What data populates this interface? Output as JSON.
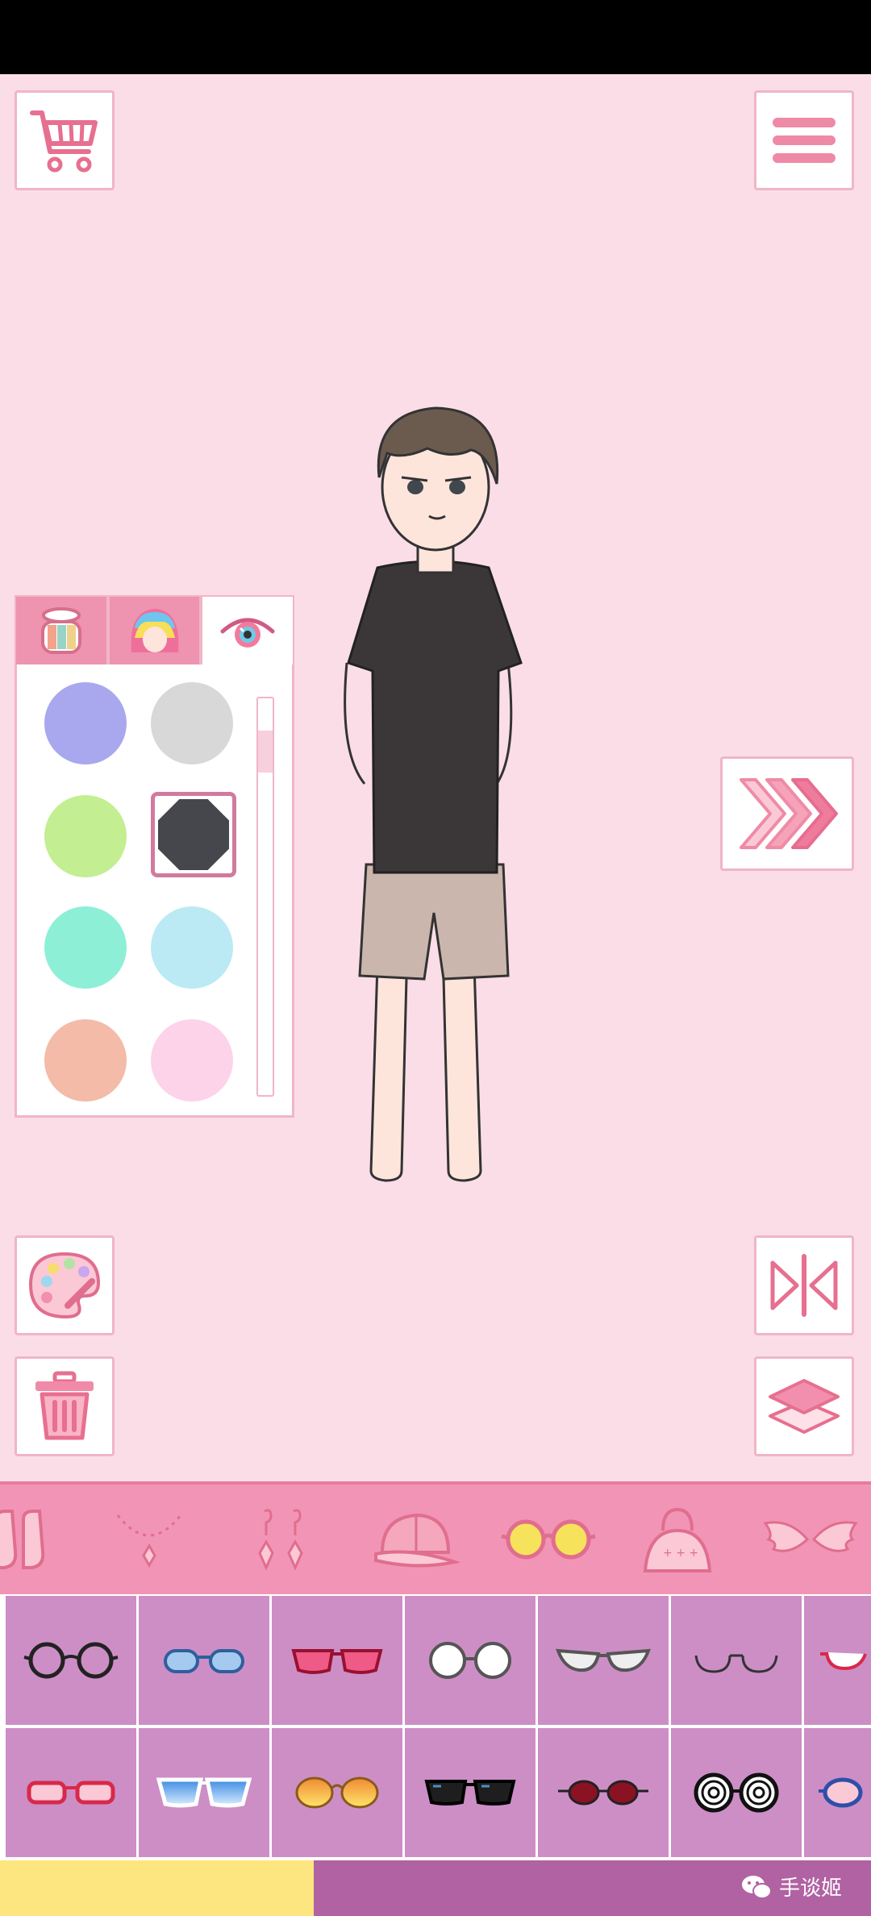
{
  "colors": {
    "stage_bg": "#fbdde8",
    "accent": "#f294b6",
    "grid_cell": "#cd8ec6",
    "progress": "#fde680"
  },
  "top_bar": {
    "left_icon": "shopping-cart-icon",
    "right_icon": "hamburger-menu-icon"
  },
  "color_panel": {
    "tabs": [
      {
        "icon": "eyeshadow-icon",
        "active": false
      },
      {
        "icon": "rainbow-hair-icon",
        "active": false
      },
      {
        "icon": "eye-color-icon",
        "active": true
      }
    ],
    "swatches": [
      {
        "color": "#a9a8ee"
      },
      {
        "color": "#d8d8d8"
      },
      {
        "color": "#c3ee91"
      },
      {
        "color": "#45474c",
        "selected": true
      },
      {
        "color": "#8eefd7"
      },
      {
        "color": "#bceaf4"
      },
      {
        "color": "#f3bba8"
      },
      {
        "color": "#fdd3ea"
      }
    ],
    "scroll_position": 0.1
  },
  "side_buttons": {
    "next_icon": "triple-chevron-right-icon",
    "palette_icon": "palette-icon",
    "trash_icon": "trash-icon",
    "flip_icon": "flip-horizontal-icon",
    "layers_icon": "layers-icon"
  },
  "categories": [
    {
      "icon": "shoes-icon"
    },
    {
      "icon": "necklace-icon"
    },
    {
      "icon": "earrings-icon"
    },
    {
      "icon": "cap-icon"
    },
    {
      "icon": "glasses-icon",
      "active": true
    },
    {
      "icon": "handbag-icon"
    },
    {
      "icon": "wings-icon"
    }
  ],
  "items": [
    {
      "icon": "round-black-glasses-icon"
    },
    {
      "icon": "blue-oval-glasses-icon"
    },
    {
      "icon": "red-tinted-sunglasses-icon"
    },
    {
      "icon": "round-gray-glasses-icon"
    },
    {
      "icon": "cat-eye-glasses-icon"
    },
    {
      "icon": "half-rim-glasses-icon"
    },
    {
      "icon": "red-partial-glasses-icon"
    },
    {
      "icon": "red-rectangular-glasses-icon"
    },
    {
      "icon": "blue-gradient-sunglasses-icon"
    },
    {
      "icon": "orange-gradient-sunglasses-icon"
    },
    {
      "icon": "black-sunglasses-icon"
    },
    {
      "icon": "red-round-sunglasses-icon"
    },
    {
      "icon": "hypno-spiral-glasses-icon"
    },
    {
      "icon": "blue-partial-glasses-icon"
    }
  ],
  "bottom_bar": {
    "progress": 0.36,
    "watermark": "手谈姬"
  }
}
